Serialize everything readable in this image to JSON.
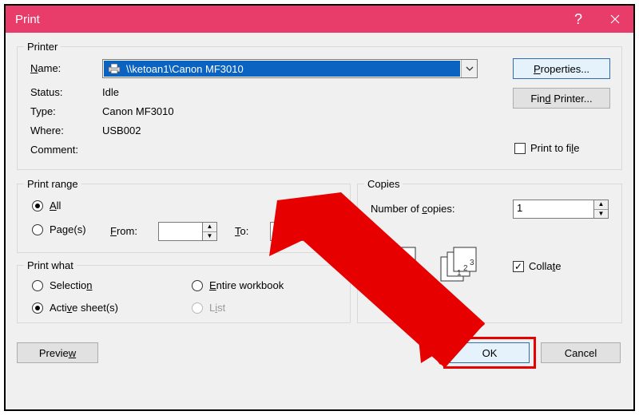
{
  "title": "Print",
  "printer": {
    "group_label": "Printer",
    "name_label": "Name:",
    "name_value": "\\\\ketoan1\\Canon MF3010",
    "status_label": "Status:",
    "status_value": "Idle",
    "type_label": "Type:",
    "type_value": "Canon MF3010",
    "where_label": "Where:",
    "where_value": "USB002",
    "comment_label": "Comment:",
    "properties_btn": "Properties...",
    "find_printer_btn": "Find Printer...",
    "print_to_file": {
      "label": "Print to file",
      "checked": false
    }
  },
  "print_range": {
    "group_label": "Print range",
    "all_label": "All",
    "pages_label": "Page(s)",
    "from_label": "From:",
    "to_label": "To:",
    "from_value": "",
    "to_value": "",
    "selected": "all"
  },
  "copies": {
    "group_label": "Copies",
    "num_label": "Number of copies:",
    "num_value": "1",
    "collate": {
      "label": "Collate",
      "checked": true
    }
  },
  "print_what": {
    "group_label": "Print what",
    "selection_label": "Selection",
    "active_sheets_label": "Active sheet(s)",
    "entire_wb_label": "Entire workbook",
    "list_label": "List",
    "selected": "active_sheets",
    "list_enabled": false
  },
  "buttons": {
    "preview": "Preview",
    "ok": "OK",
    "cancel": "Cancel"
  },
  "annotation": {
    "highlight_target": "ok-button"
  }
}
